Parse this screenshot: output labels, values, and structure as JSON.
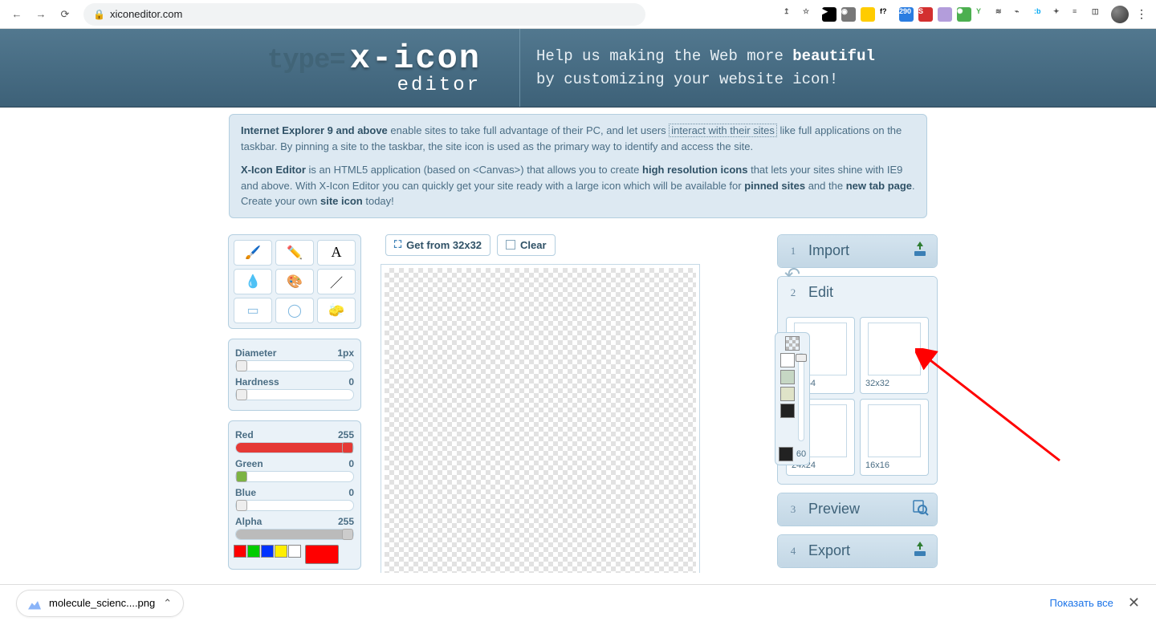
{
  "browser": {
    "url": "xiconeditor.com",
    "extensions": [
      {
        "bg": "#fff",
        "txt": "↥",
        "c": "#555"
      },
      {
        "bg": "#fff",
        "txt": "☆",
        "c": "#555"
      },
      {
        "bg": "#000",
        "txt": "▶",
        "c": "#fff"
      },
      {
        "bg": "#777",
        "txt": "◉",
        "c": "#fff"
      },
      {
        "bg": "#ffcc00",
        "txt": "",
        "c": "#000"
      },
      {
        "bg": "#fff",
        "txt": "f?",
        "c": "#000"
      },
      {
        "bg": "#2a7de1",
        "txt": "290",
        "c": "#fff"
      },
      {
        "bg": "#d32f2f",
        "txt": "S",
        "c": "#fff"
      },
      {
        "bg": "#b39ddb",
        "txt": "",
        "c": "#fff"
      },
      {
        "bg": "#4caf50",
        "txt": "✺",
        "c": "#fff"
      },
      {
        "bg": "#fff",
        "txt": "Y",
        "c": "#4caf50"
      },
      {
        "bg": "#fff",
        "txt": "≋",
        "c": "#555"
      },
      {
        "bg": "#fff",
        "txt": "⌁",
        "c": "#555"
      },
      {
        "bg": "#fff",
        "txt": ":b",
        "c": "#03a9f4"
      },
      {
        "bg": "#fff",
        "txt": "✦",
        "c": "#555"
      },
      {
        "bg": "#fff",
        "txt": "≡",
        "c": "#555"
      },
      {
        "bg": "#fff",
        "txt": "◫",
        "c": "#555"
      }
    ]
  },
  "header": {
    "type_prefix": "type=",
    "logo": "x-icon",
    "subtitle": "editor",
    "tag_line1_a": "Help us making the Web more ",
    "tag_line1_b": "beautiful",
    "tag_line2": "by customizing your website icon!"
  },
  "intro": {
    "p1_a": "Internet Explorer 9 and above",
    "p1_b": " enable sites to take full advantage of their PC, and let users ",
    "p1_link": "interact with their sites",
    "p1_c": " like full applications on the taskbar. By pinning a site to the taskbar, the site icon is used as the primary way to identify and access the site.",
    "p2_a": "X-Icon Editor",
    "p2_b": " is an HTML5 application (based on <Canvas>) that allows you to create ",
    "p2_c": "high resolution icons",
    "p2_d": " that lets your sites shine with IE9 and above. With X-Icon Editor you can quickly get your site ready with a large icon which will be available for ",
    "p2_e": "pinned sites",
    "p2_f": " and the ",
    "p2_g": "new tab page",
    "p2_h": ". Create your own ",
    "p2_i": "site icon",
    "p2_j": " today!"
  },
  "tools": {
    "items": [
      "brush-icon",
      "pencil-icon",
      "text-icon",
      "eyedropper-icon",
      "bucket-icon",
      "line-icon",
      "rectangle-icon",
      "ellipse-icon",
      "eraser-icon"
    ]
  },
  "brush_sliders": {
    "diameter_label": "Diameter",
    "diameter_value": "1px",
    "hardness_label": "Hardness",
    "hardness_value": "0"
  },
  "color_sliders": {
    "red_label": "Red",
    "red_value": "255",
    "green_label": "Green",
    "green_value": "0",
    "blue_label": "Blue",
    "blue_value": "0",
    "alpha_label": "Alpha",
    "alpha_value": "255"
  },
  "swatches": [
    "#ff0000",
    "#00cc00",
    "#0033ff",
    "#ffee00",
    "#ffffff"
  ],
  "current_color": "#ff0000",
  "canvas": {
    "get_btn": "Get from 32x32",
    "clear_btn": "Clear"
  },
  "mini_palette": {
    "colors": [
      "#ffffff",
      "#c6d7c4",
      "#dfe3c8",
      "#222222"
    ],
    "slider_label": "60"
  },
  "steps": {
    "s1_num": "1",
    "s1": "Import",
    "s2_num": "2",
    "s2": "Edit",
    "s3_num": "3",
    "s3": "Preview",
    "s4_num": "4",
    "s4": "Export",
    "sizes": [
      "64x64",
      "32x32",
      "24x24",
      "16x16"
    ]
  },
  "download": {
    "file": "molecule_scienc....png",
    "show_all": "Показать все"
  }
}
